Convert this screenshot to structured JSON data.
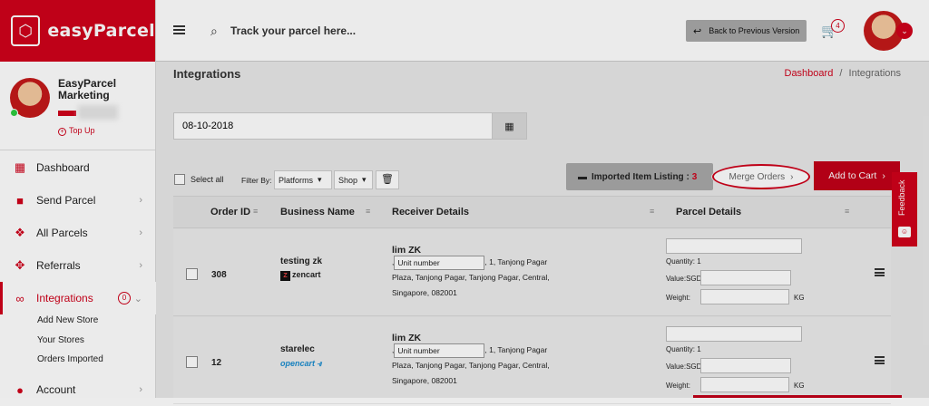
{
  "app": {
    "logo_text": "easyParcel"
  },
  "profile": {
    "name": "EasyParcel Marketing",
    "topup": "Top Up"
  },
  "sidebar": {
    "items": [
      {
        "label": "Dashboard",
        "icon": "dashboard-icon"
      },
      {
        "label": "Send Parcel",
        "icon": "truck-icon"
      },
      {
        "label": "All Parcels",
        "icon": "boxes-icon"
      },
      {
        "label": "Referrals",
        "icon": "users-icon"
      },
      {
        "label": "Integrations",
        "icon": "link-icon",
        "badge": "0"
      },
      {
        "label": "Account",
        "icon": "user-icon"
      }
    ],
    "sub_items": [
      "Add New Store",
      "Your Stores",
      "Orders Imported"
    ]
  },
  "topbar": {
    "search_placeholder": "Track your parcel here...",
    "back_button": "Back to Previous Version",
    "cart_count": "4"
  },
  "page": {
    "title": "Integrations",
    "breadcrumb_home": "Dashboard",
    "breadcrumb_sep": "/",
    "breadcrumb_current": "Integrations"
  },
  "date_filter": {
    "value": "08-10-2018"
  },
  "toolbar": {
    "select_all": "Select all",
    "filter_by": "Filter By:",
    "platforms": "Platforms",
    "shop": "Shop",
    "imported_label": "Imported Item Listing :",
    "imported_count": "3",
    "merge_orders": "Merge Orders",
    "add_to_cart": "Add to Cart"
  },
  "table": {
    "headers": [
      "Order ID",
      "Business Name",
      "Receiver Details",
      "Parcel Details"
    ],
    "rows": [
      {
        "order_id": "308",
        "business": "testing zk",
        "platform": "zencart",
        "receiver": "lim ZK",
        "unit_placeholder": "Unit number",
        "addr1": ", 1, Tanjong Pagar",
        "addr2": "Plaza, Tanjong Pagar, Tanjong Pagar, Central,",
        "addr3": "Singapore, 082001",
        "quantity": "Quantity: 1",
        "value": "Value:SGD",
        "weight": "Weight:",
        "kg": "KG"
      },
      {
        "order_id": "12",
        "business": "starelec",
        "platform": "opencart",
        "receiver": "lim ZK",
        "unit_placeholder": "Unit number",
        "addr1": ", 1, Tanjong Pagar",
        "addr2": "Plaza, Tanjong Pagar, Tanjong Pagar, Central,",
        "addr3": "Singapore, 082001",
        "quantity": "Quantity: 1",
        "value": "Value:SGD",
        "weight": "Weight:",
        "kg": "KG"
      }
    ]
  },
  "feedback": {
    "label": "Feedback"
  },
  "colors": {
    "brand_red": "#d0021b",
    "button_gray": "#a9a9a9"
  }
}
